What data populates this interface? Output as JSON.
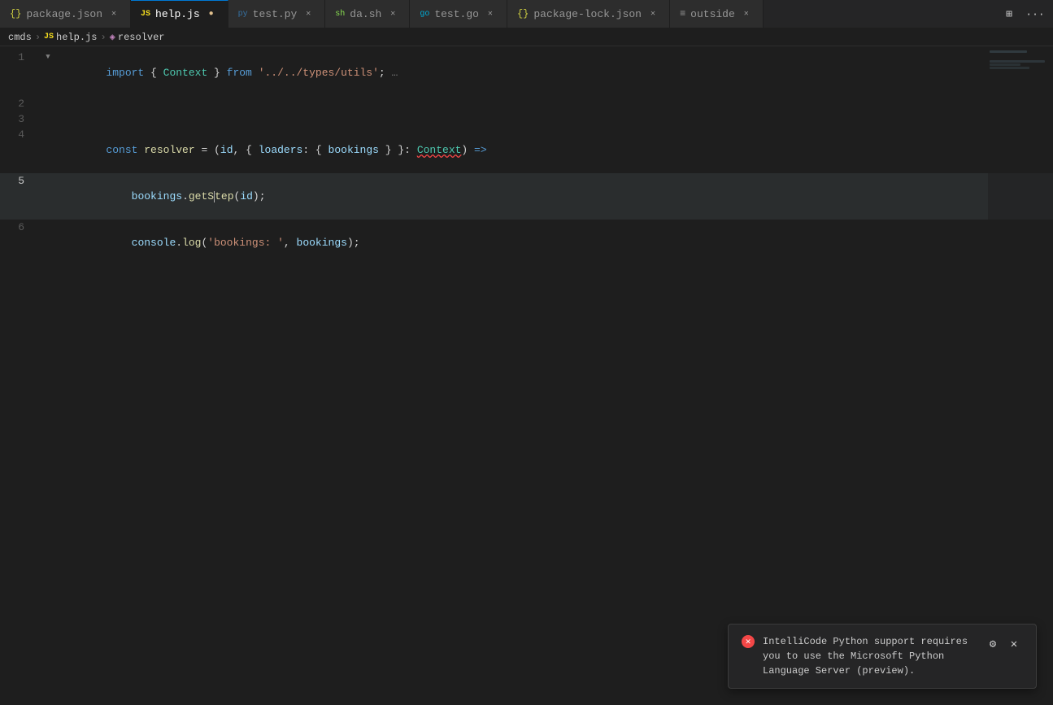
{
  "tabs": [
    {
      "id": "package-json",
      "label": "package.json",
      "icon": "{}",
      "iconClass": "icon-json",
      "active": false,
      "dirty": false
    },
    {
      "id": "help-js",
      "label": "help.js",
      "icon": "JS",
      "iconClass": "icon-js",
      "active": true,
      "dirty": true
    },
    {
      "id": "test-py",
      "label": "test.py",
      "icon": "py",
      "iconClass": "icon-py",
      "active": false,
      "dirty": false
    },
    {
      "id": "da-sh",
      "label": "da.sh",
      "icon": "sh",
      "iconClass": "icon-sh",
      "active": false,
      "dirty": false
    },
    {
      "id": "test-go",
      "label": "test.go",
      "icon": "go",
      "iconClass": "icon-go",
      "active": false,
      "dirty": false
    },
    {
      "id": "package-lock-json",
      "label": "package-lock.json",
      "icon": "{}",
      "iconClass": "icon-json",
      "active": false,
      "dirty": false
    },
    {
      "id": "outside",
      "label": "outside",
      "icon": "≡",
      "iconClass": "icon-text",
      "active": false,
      "dirty": false
    }
  ],
  "breadcrumb": {
    "items": [
      {
        "label": "cmds",
        "icon": ""
      },
      {
        "label": "help.js",
        "icon": "JS",
        "iconClass": "icon-js"
      },
      {
        "label": "resolver",
        "icon": "◈"
      }
    ]
  },
  "code": {
    "lines": [
      {
        "num": 1,
        "content": "import { Context } from '../../types/utils'; …",
        "hasCollapse": true
      },
      {
        "num": 2,
        "content": ""
      },
      {
        "num": 3,
        "content": ""
      },
      {
        "num": 4,
        "content": "const resolver = (id, { loaders: { bookings } }: Context) =>"
      },
      {
        "num": 5,
        "content": "  bookings.getStep(id);"
      },
      {
        "num": 6,
        "content": "  console.log('bookings: ', bookings);"
      }
    ]
  },
  "notification": {
    "message": "IntelliCode Python support requires you to use the Microsoft Python Language Server (preview).",
    "icon": "✕",
    "gearLabel": "⚙",
    "closeLabel": "✕"
  },
  "toolbar": {
    "splitEditorLabel": "⊞",
    "moreActionsLabel": "…"
  }
}
